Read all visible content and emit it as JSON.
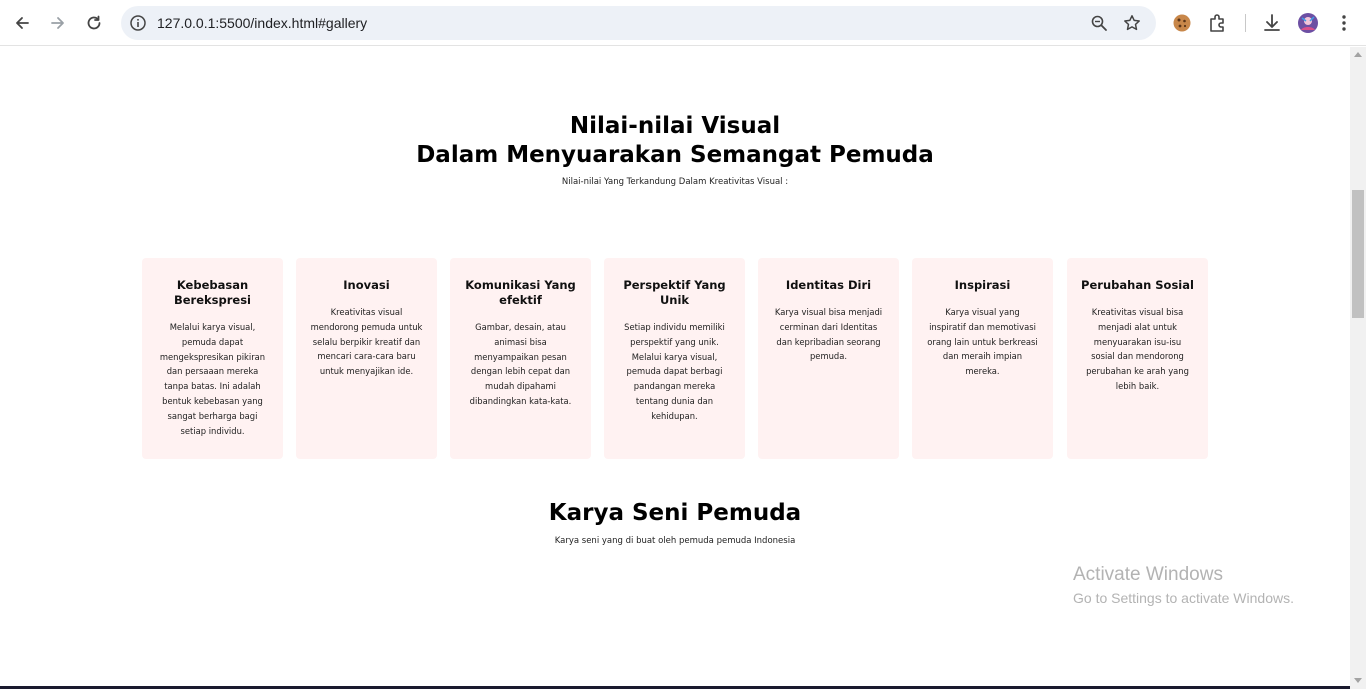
{
  "browser": {
    "url": "127.0.0.1:5500/index.html#gallery",
    "icons": [
      "back-icon",
      "forward-icon",
      "reload-icon",
      "site-info-icon",
      "zoom-icon",
      "bookmark-star-icon",
      "cookie-extension-icon",
      "extensions-puzzle-icon",
      "download-icon",
      "profile-avatar",
      "menu-kebab-icon"
    ]
  },
  "values_section": {
    "title_line1": "Nilai-nilai Visual",
    "title_line2": "Dalam Menyuarakan Semangat Pemuda",
    "subtitle": "Nilai-nilai Yang Terkandung Dalam Kreativitas Visual :",
    "cards": [
      {
        "title": "Kebebasan Berekspresi",
        "text": "Melalui karya visual, pemuda dapat mengekspresikan pikiran dan persaaan mereka tanpa batas. Ini adalah bentuk kebebasan yang sangat berharga bagi setiap individu."
      },
      {
        "title": "Inovasi",
        "text": "Kreativitas visual mendorong pemuda untuk selalu berpikir kreatif dan mencari cara-cara baru untuk menyajikan ide."
      },
      {
        "title": "Komunikasi Yang efektif",
        "text": "Gambar, desain, atau animasi bisa menyampaikan pesan dengan lebih cepat dan mudah dipahami dibandingkan kata-kata."
      },
      {
        "title": "Perspektif Yang Unik",
        "text": "Setiap individu memiliki perspektif yang unik. Melalui karya visual, pemuda dapat berbagi pandangan mereka tentang dunia dan kehidupan."
      },
      {
        "title": "Identitas Diri",
        "text": "Karya visual bisa menjadi cerminan dari Identitas dan kepribadian seorang pemuda."
      },
      {
        "title": "Inspirasi",
        "text": "Karya visual yang inspiratif dan memotivasi orang lain untuk berkreasi dan meraih impian mereka."
      },
      {
        "title": "Perubahan Sosial",
        "text": "Kreativitas visual bisa menjadi alat untuk menyuarakan isu-isu sosial dan mendorong perubahan ke arah yang lebih baik."
      }
    ]
  },
  "gallery_section": {
    "title": "Karya Seni Pemuda",
    "subtitle": "Karya seni yang di buat oleh pemuda pemuda Indonesia"
  },
  "watermark": {
    "line1": "Activate Windows",
    "line2": "Go to Settings to activate Windows."
  },
  "colors": {
    "card_background": "#fff2f2",
    "omnibox_background": "#edf1f7"
  }
}
